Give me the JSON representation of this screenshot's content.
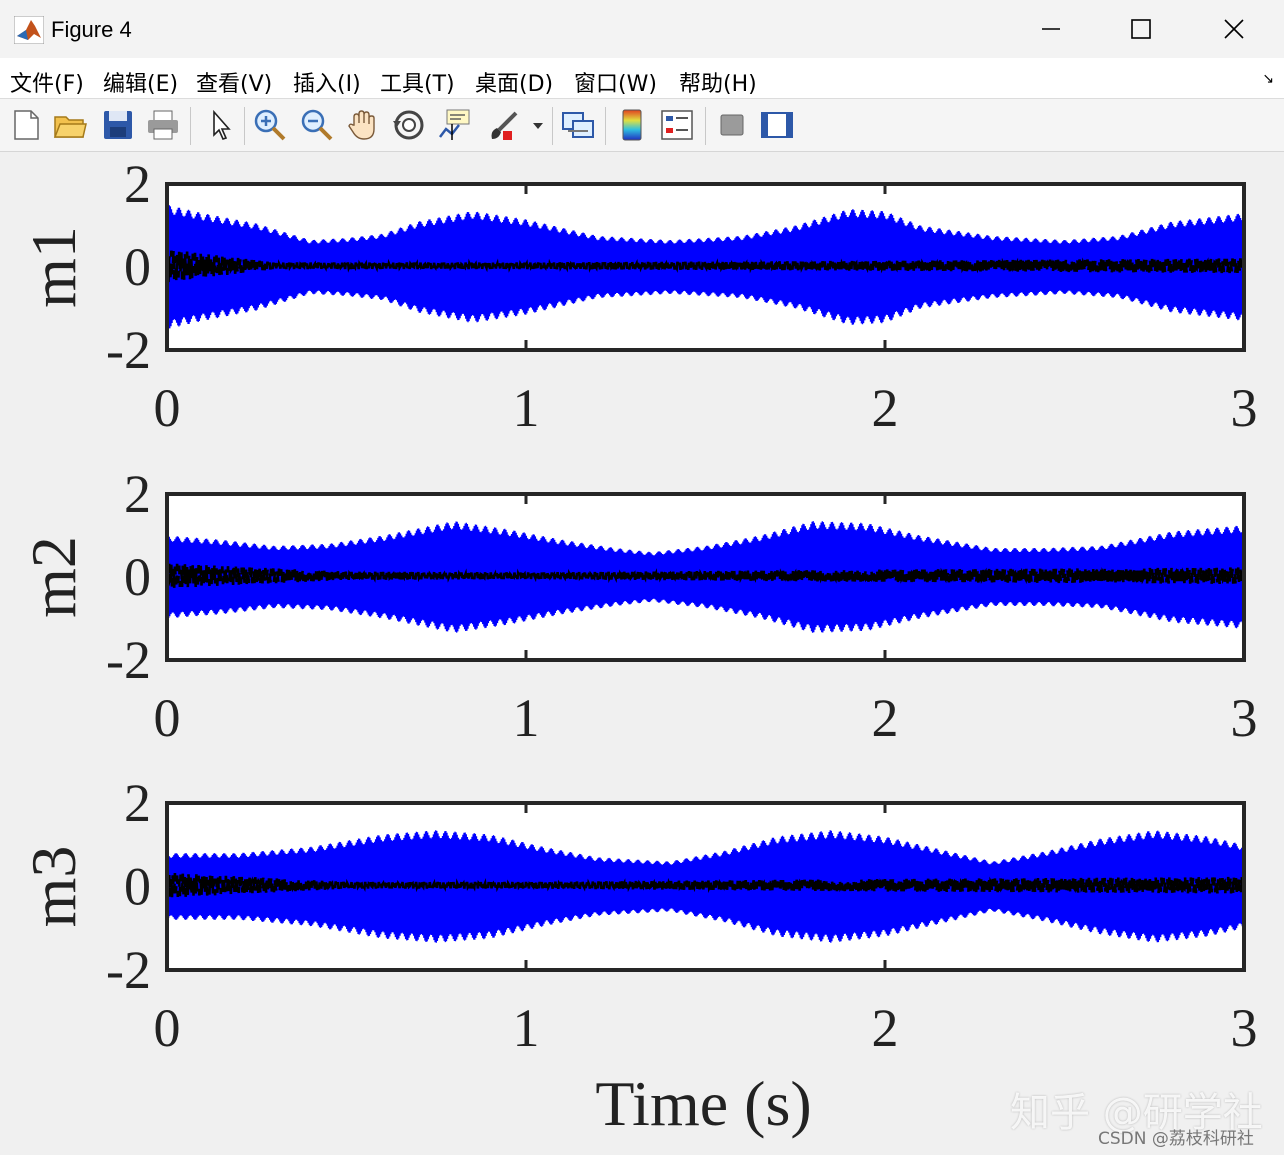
{
  "window": {
    "title": "Figure 4"
  },
  "menu": {
    "items": [
      "文件(F)",
      "编辑(E)",
      "查看(V)",
      "插入(I)",
      "工具(T)",
      "桌面(D)",
      "窗口(W)",
      "帮助(H)"
    ]
  },
  "toolbar": {
    "icons": [
      "new-figure-icon",
      "open-file-icon",
      "save-icon",
      "print-icon",
      "select-arrow-icon",
      "zoom-in-icon",
      "zoom-out-icon",
      "pan-hand-icon",
      "rotate-3d-icon",
      "data-cursor-icon",
      "brush-icon",
      "brush-dropdown-icon",
      "link-plot-icon",
      "colorbar-icon",
      "legend-icon",
      "hide-plot-tools-icon",
      "show-plot-tools-icon"
    ]
  },
  "chart_data": [
    {
      "type": "line",
      "ylabel": "m1",
      "xlabel": "",
      "xlim": [
        0,
        3
      ],
      "ylim": [
        -2,
        2
      ],
      "xticks": [
        "0",
        "1",
        "2",
        "3"
      ],
      "yticks": [
        "2",
        "0",
        "-2"
      ],
      "series": [
        {
          "color": "#0000ff",
          "style": "solid",
          "envelope_x": [
            0,
            0.1,
            0.25,
            0.4,
            0.5,
            0.6,
            0.7,
            0.85,
            1.0,
            1.2,
            1.4,
            1.6,
            1.75,
            1.9,
            2.0,
            2.1,
            2.3,
            2.5,
            2.65,
            2.8,
            3.0
          ],
          "envelope_amp": [
            1.5,
            1.3,
            1.05,
            0.65,
            0.7,
            0.8,
            1.1,
            1.35,
            1.15,
            0.75,
            0.65,
            0.75,
            1.0,
            1.4,
            1.35,
            1.0,
            0.75,
            0.65,
            0.75,
            1.1,
            1.3
          ]
        },
        {
          "color": "#000000",
          "style": "dashed",
          "envelope_x": [
            0,
            0.3,
            1.0,
            2.0,
            3.0
          ],
          "envelope_amp": [
            0.4,
            0.08,
            0.08,
            0.12,
            0.18
          ]
        }
      ]
    },
    {
      "type": "line",
      "ylabel": "m2",
      "xlabel": "",
      "xlim": [
        0,
        3
      ],
      "ylim": [
        -2,
        2
      ],
      "xticks": [
        "0",
        "1",
        "2",
        "3"
      ],
      "yticks": [
        "2",
        "0",
        "-2"
      ],
      "series": [
        {
          "color": "#0000ff",
          "style": "solid",
          "envelope_x": [
            0,
            0.15,
            0.3,
            0.45,
            0.6,
            0.8,
            0.95,
            1.1,
            1.25,
            1.35,
            1.5,
            1.65,
            1.8,
            1.95,
            2.1,
            2.3,
            2.45,
            2.6,
            2.8,
            3.0
          ],
          "envelope_amp": [
            1.0,
            0.9,
            0.75,
            0.8,
            1.0,
            1.35,
            1.15,
            0.9,
            0.7,
            0.6,
            0.75,
            1.0,
            1.35,
            1.3,
            1.0,
            0.7,
            0.7,
            0.75,
            1.1,
            1.25
          ]
        },
        {
          "color": "#000000",
          "style": "dashed",
          "envelope_x": [
            0,
            0.5,
            1.0,
            2.0,
            3.0
          ],
          "envelope_amp": [
            0.3,
            0.1,
            0.08,
            0.15,
            0.2
          ]
        }
      ]
    },
    {
      "type": "line",
      "ylabel": "m3",
      "xlabel": "Time (s)",
      "xlim": [
        0,
        3
      ],
      "ylim": [
        -2,
        2
      ],
      "xticks": [
        "0",
        "1",
        "2",
        "3"
      ],
      "yticks": [
        "2",
        "0",
        "-2"
      ],
      "series": [
        {
          "color": "#0000ff",
          "style": "solid",
          "envelope_x": [
            0,
            0.2,
            0.4,
            0.6,
            0.75,
            0.9,
            1.05,
            1.2,
            1.4,
            1.55,
            1.7,
            1.85,
            2.0,
            2.15,
            2.3,
            2.45,
            2.6,
            2.75,
            2.9,
            3.0
          ],
          "envelope_amp": [
            0.8,
            0.8,
            0.95,
            1.25,
            1.35,
            1.25,
            0.95,
            0.7,
            0.6,
            0.85,
            1.2,
            1.35,
            1.2,
            0.9,
            0.6,
            0.85,
            1.15,
            1.35,
            1.2,
            1.0
          ]
        },
        {
          "color": "#000000",
          "style": "dashed",
          "envelope_x": [
            0,
            0.5,
            1.0,
            2.0,
            3.0
          ],
          "envelope_amp": [
            0.3,
            0.08,
            0.08,
            0.15,
            0.2
          ]
        }
      ]
    }
  ],
  "watermark": {
    "zhihu": "知乎 @研学社",
    "csdn": "CSDN @荔枝科研社"
  }
}
